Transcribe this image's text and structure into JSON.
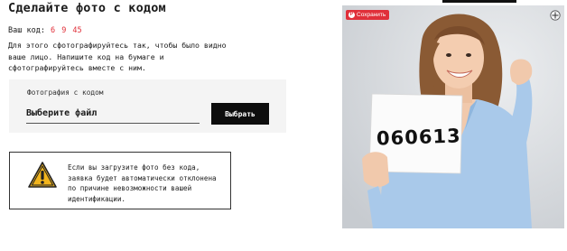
{
  "header": {
    "title": "Сделайте фото с кодом"
  },
  "code": {
    "label": "Ваш код:",
    "value": "6 9 45"
  },
  "instructions": "Для этого сфотографируйтесь так, чтобы было видно ваше лицо. Напишите код на бумаге и сфотографируйтесь вместе с ним.",
  "upload": {
    "label": "Фотография с кодом",
    "file_placeholder": "Выберите файл",
    "button_label": "Выбрать"
  },
  "warning": {
    "icon": "warning-triangle-icon",
    "text": "Если вы загрузите фото без кода, заявка будет автоматически отклонена по причине невозможности вашей идентификации."
  },
  "example_photo": {
    "save_label": "Сохранить",
    "sign_code": "060613",
    "accent_color": "#e0303a"
  }
}
